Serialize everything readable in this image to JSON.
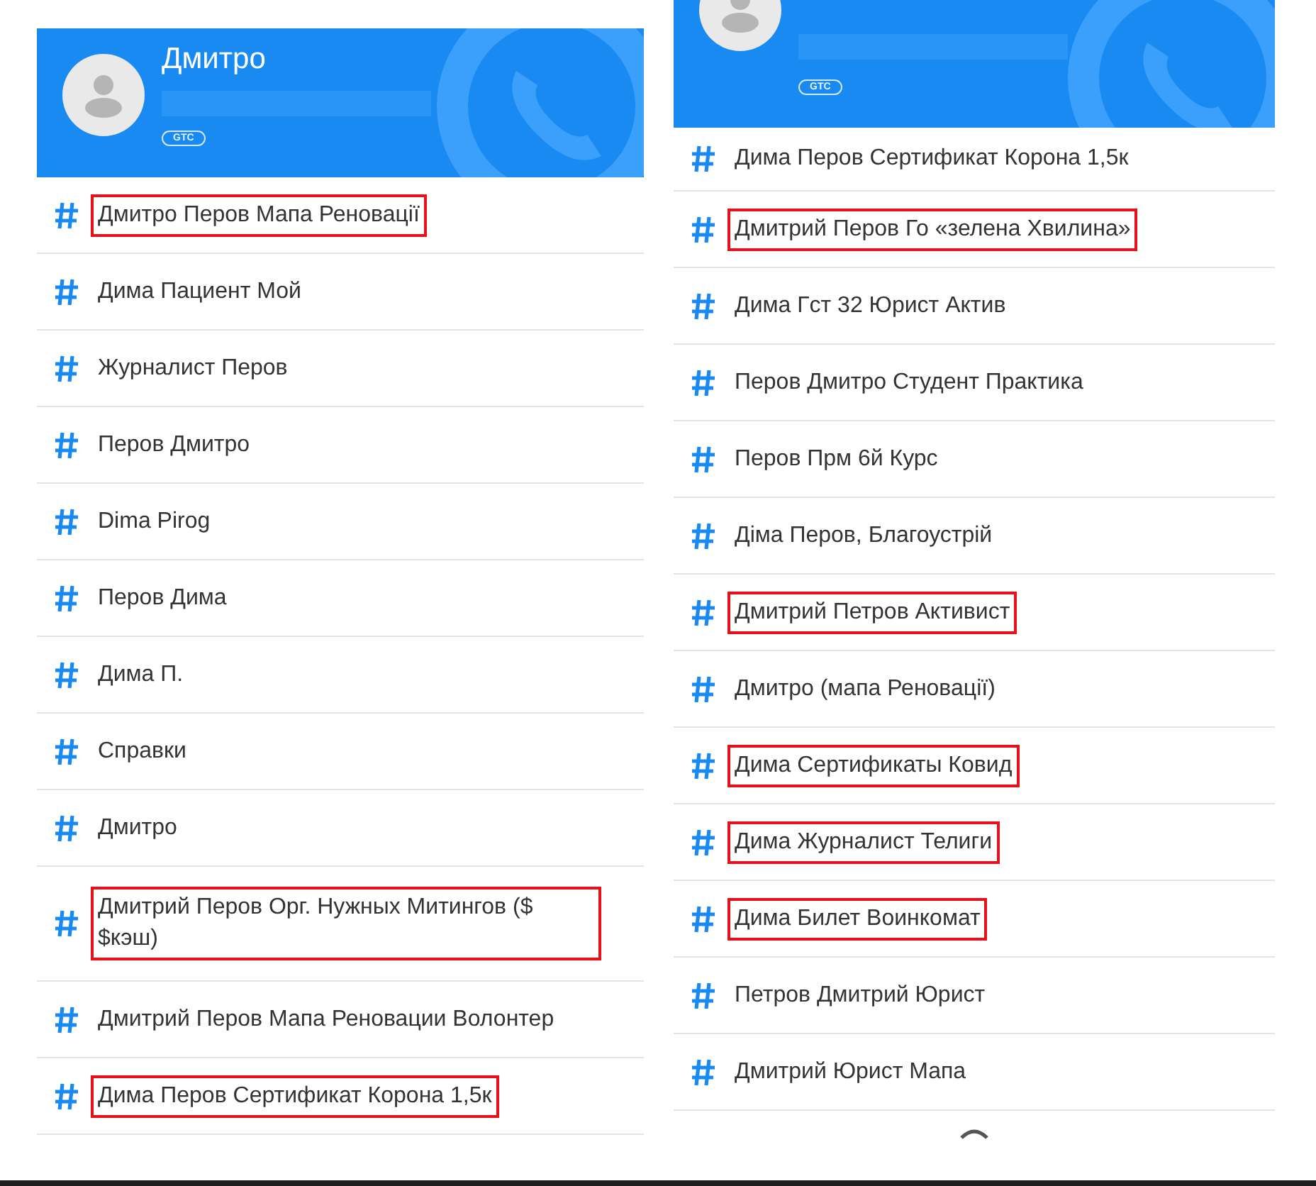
{
  "panels": [
    {
      "header": {
        "name": "Дмитро",
        "badge": "GTC"
      },
      "tags": [
        {
          "text": "Дмитро Перов Мапа Реновації",
          "highlighted": true
        },
        {
          "text": "Дима Пациент Мой",
          "highlighted": false
        },
        {
          "text": "Журналист Перов",
          "highlighted": false
        },
        {
          "text": "Перов Дмитро",
          "highlighted": false
        },
        {
          "text": "Dima Pirog",
          "highlighted": false
        },
        {
          "text": "Перов Дима",
          "highlighted": false
        },
        {
          "text": "Дима П.",
          "highlighted": false
        },
        {
          "text": "Справки",
          "highlighted": false
        },
        {
          "text": "Дмитро",
          "highlighted": false
        },
        {
          "text": "Дмитрий Перов Орг. Нужных Митингов ($ $кэш)",
          "highlighted": true
        },
        {
          "text": "Дмитрий Перов Мапа Реновации Волонтер",
          "highlighted": false
        },
        {
          "text": "Дима Перов Сертификат Корона 1,5к",
          "highlighted": true
        }
      ]
    },
    {
      "header": {
        "badge": "GTC"
      },
      "loading": true,
      "tags": [
        {
          "text": "Дима Перов Сертификат Корона 1,5к",
          "highlighted": false
        },
        {
          "text": "Дмитрий Перов Го «зелена Хвилина»",
          "highlighted": true
        },
        {
          "text": "Дима Гст 32 Юрист Актив",
          "highlighted": false
        },
        {
          "text": "Перов Дмитро Студент Практика",
          "highlighted": false
        },
        {
          "text": "Перов Прм 6й Курс",
          "highlighted": false
        },
        {
          "text": "Діма Перов, Благоустрій",
          "highlighted": false
        },
        {
          "text": "Дмитрий Петров Активист",
          "highlighted": true
        },
        {
          "text": "Дмитро (мапа Реновації)",
          "highlighted": false
        },
        {
          "text": "Дима Сертификаты Ковид",
          "highlighted": true
        },
        {
          "text": "Дима Журналист Телиги",
          "highlighted": true
        },
        {
          "text": "Дима Билет Воинкомат",
          "highlighted": true
        },
        {
          "text": "Петров Дмитрий Юрист",
          "highlighted": false
        },
        {
          "text": "Дмитрий Юрист Мапа",
          "highlighted": false
        }
      ]
    }
  ]
}
